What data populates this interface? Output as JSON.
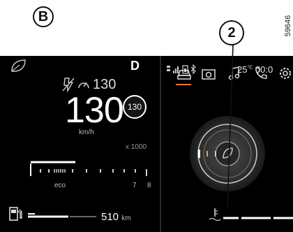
{
  "figure": {
    "panel_label": "B",
    "reference_number": "2",
    "figure_code": "59646"
  },
  "dashboard": {
    "gear": "D",
    "speed_limit_value": "130",
    "speed": "130",
    "speed_unit": "km/h",
    "cruise_setpoint": "130",
    "rpm_multiplier": "x 1000",
    "gauge_left_label": "eco",
    "gauge_tick_7": "7",
    "gauge_tick_8": "8",
    "range_value": "510",
    "range_unit": "km"
  },
  "status_bar": {
    "temperature": "25",
    "temperature_unit": "°C",
    "clock": "00:0"
  },
  "tabs": [
    "car-icon",
    "camera-icon",
    "music-icon",
    "phone-icon",
    "settings-icon"
  ],
  "colors": {
    "background": "#000000",
    "accent": "#e07b3a",
    "text": "#ffffff"
  }
}
